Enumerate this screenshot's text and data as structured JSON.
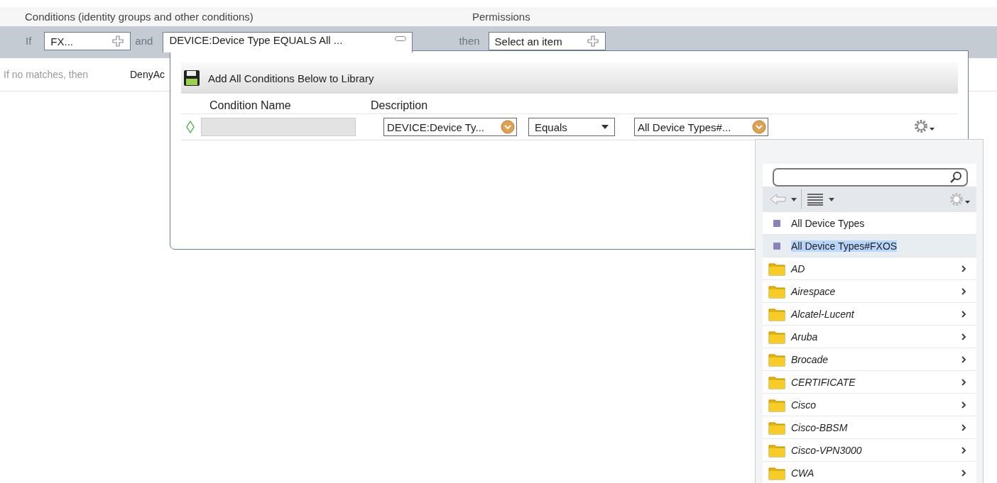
{
  "header": {
    "conditions_label": "Conditions (identity groups and other conditions)",
    "permissions_label": "Permissions"
  },
  "rule_bar": {
    "if_label": "If",
    "identity_group": "FX...",
    "and_label": "and",
    "condition_tab": "DEVICE:Device Type EQUALS All ...",
    "then_label": "then",
    "permission": "Select an item"
  },
  "default_row": {
    "label": "If no matches, then",
    "value": "DenyAc"
  },
  "condition_panel": {
    "toolbar_button": "Add All Conditions Below to Library",
    "columns": [
      "Condition Name",
      "Description"
    ],
    "rows": [
      {
        "attribute": "DEVICE:Device Ty...",
        "operator": "Equals",
        "value": "All Device Types#..."
      }
    ]
  },
  "dropdown": {
    "items": [
      {
        "kind": "item",
        "label": "All Device Types",
        "selected": false
      },
      {
        "kind": "item",
        "label": "All Device Types#FXOS",
        "selected": true
      },
      {
        "kind": "folder",
        "label": "AD",
        "selected": false
      },
      {
        "kind": "folder",
        "label": "Airespace",
        "selected": false
      },
      {
        "kind": "folder",
        "label": "Alcatel-Lucent",
        "selected": false
      },
      {
        "kind": "folder",
        "label": "Aruba",
        "selected": false
      },
      {
        "kind": "folder",
        "label": "Brocade",
        "selected": false
      },
      {
        "kind": "folder",
        "label": "CERTIFICATE",
        "selected": false
      },
      {
        "kind": "folder",
        "label": "Cisco",
        "selected": false
      },
      {
        "kind": "folder",
        "label": "Cisco-BBSM",
        "selected": false
      },
      {
        "kind": "folder",
        "label": "Cisco-VPN3000",
        "selected": false
      },
      {
        "kind": "folder",
        "label": "CWA",
        "selected": false
      }
    ]
  }
}
